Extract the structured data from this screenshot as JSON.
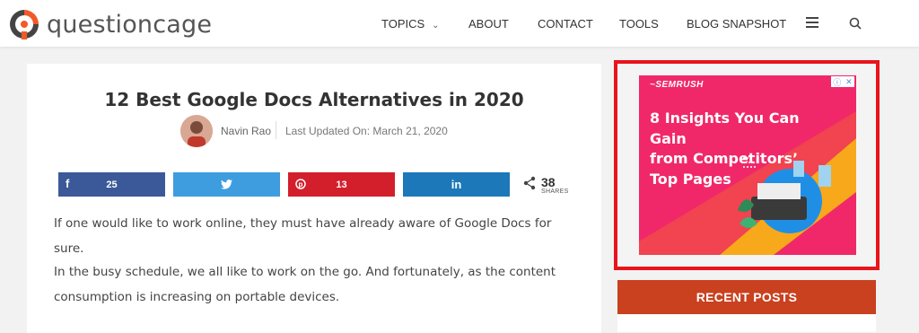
{
  "header": {
    "logo_text": "questioncage",
    "nav": [
      {
        "label": "TOPICS",
        "has_dropdown": true
      },
      {
        "label": "ABOUT"
      },
      {
        "label": "CONTACT"
      },
      {
        "label": "TOOLS"
      },
      {
        "label": "BLOG SNAPSHOT"
      }
    ],
    "menu_icon": "hamburger-icon",
    "search_icon": "search-icon"
  },
  "article": {
    "title": "12 Best Google Docs Alternatives in 2020",
    "author": "Navin Rao",
    "updated": "Last Updated On: March 21, 2020",
    "share": [
      {
        "network": "facebook",
        "icon": "facebook-icon",
        "count": "25",
        "color": "#3b5998"
      },
      {
        "network": "twitter",
        "icon": "twitter-icon",
        "count": "",
        "color": "#3d9ddf"
      },
      {
        "network": "pinterest",
        "icon": "pinterest-icon",
        "count": "13",
        "color": "#d21f2b"
      },
      {
        "network": "linkedin",
        "icon": "linkedin-icon",
        "count": "",
        "color": "#1c78b8"
      }
    ],
    "total_shares": "38",
    "shares_label": "SHARES",
    "paragraphs": [
      "If one would like to work online, they must have already aware of Google Docs for sure.",
      "In the busy schedule, we all like to work on the go. And fortunately, as the content",
      "consumption is increasing on portable devices."
    ]
  },
  "ad": {
    "brand": "SEMRUSH",
    "headline_lines": [
      "8 Insights You Can Gain",
      "from Competitors’",
      "Top Pages"
    ],
    "highlight_color": "#e8141c",
    "background_color": "#f0286a"
  },
  "sidebar": {
    "recent_posts_label": "RECENT POSTS",
    "accent": "#c9411f"
  }
}
